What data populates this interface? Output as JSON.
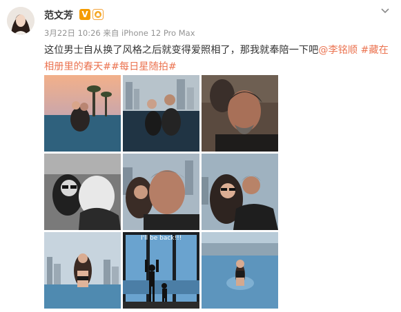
{
  "user": {
    "name": "范文芳",
    "verified_badge": "V"
  },
  "meta": {
    "text": "3月22日 10:26 来自 iPhone 12 Pro Max"
  },
  "post": {
    "text": "这位男士自从换了风格之后就变得爱照相了，那我就奉陪一下吧",
    "mention": "@李铭顺",
    "hashtag_1": "#藏在相册里的春天#",
    "hashtag_2": "#每日星随拍#"
  },
  "images": [
    {
      "icon": "couple-sunset-pool-photo"
    },
    {
      "icon": "couple-infinity-pool-photo"
    },
    {
      "icon": "man-selfie-photo"
    },
    {
      "icon": "bw-couple-photo"
    },
    {
      "icon": "couple-skyline-selfie-photo"
    },
    {
      "icon": "couple-closeup-photo"
    },
    {
      "icon": "woman-rooftop-pool-photo"
    },
    {
      "icon": "window-silhouettes-photo",
      "caption": "I'll be back!!!"
    },
    {
      "icon": "woman-pool-water-photo"
    }
  ],
  "colors": {
    "link": "#eb7350",
    "meta": "#939393",
    "badge": "#f59b00"
  }
}
